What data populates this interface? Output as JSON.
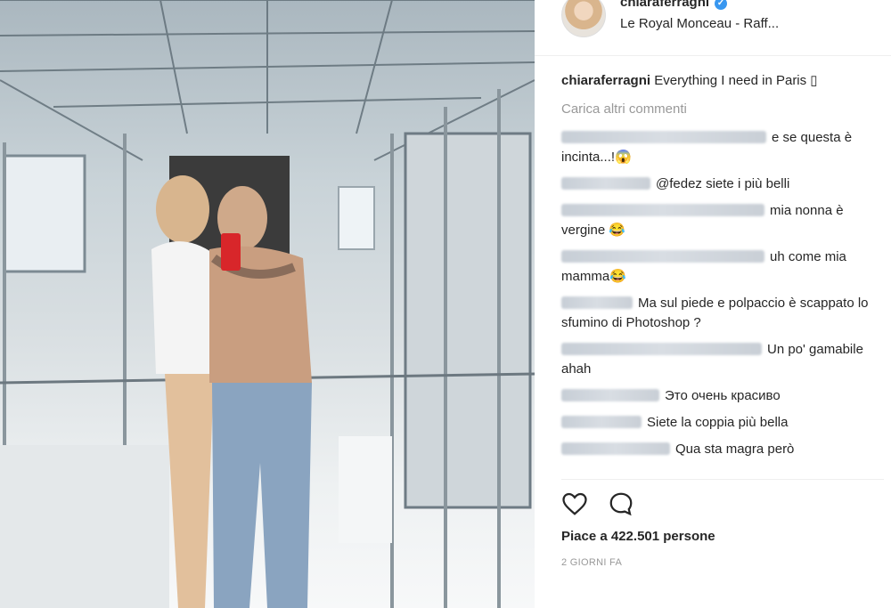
{
  "post": {
    "username": "chiaraferragni",
    "location": "Le Royal Monceau - Raff...",
    "caption_user": "chiaraferragni",
    "caption_text": "Everything I need in Paris ▯",
    "load_more": "Carica altri commenti",
    "likes": "Piace a 422.501 persone",
    "time": "2 GIORNI FA"
  },
  "comments": [
    {
      "text": "e se questa è incinta...!😱"
    },
    {
      "text": "@fedez siete i più belli"
    },
    {
      "text": "mia nonna è vergine 😂"
    },
    {
      "text": "uh come mia mamma😂"
    },
    {
      "text": "Ma sul piede e polpaccio è scappato lo sfumino di Photoshop ?"
    },
    {
      "text": "Un po' gamabile ahah"
    },
    {
      "text": "Это очень красиво"
    },
    {
      "text": "Siete la coppia più bella"
    },
    {
      "text": "Qua sta magra però"
    }
  ],
  "icons": {
    "verified": "verified-badge",
    "like": "heart-icon",
    "comment": "comment-bubble-icon"
  },
  "colors": {
    "verified": "#3897f0",
    "muted": "#999999",
    "text": "#262626"
  }
}
